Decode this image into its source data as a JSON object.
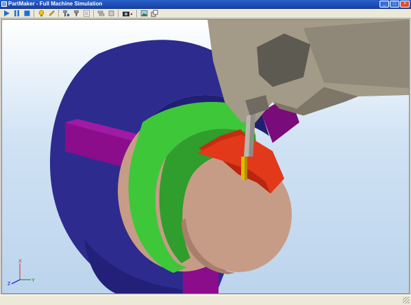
{
  "window": {
    "title": "PartMaker - Full Machine Simulation",
    "buttons": {
      "minimize": "_",
      "maximize": "□",
      "close": "×"
    }
  },
  "toolbar": {
    "icons": [
      "play-icon",
      "pause-icon",
      "stop-icon",
      "light-bulb-icon",
      "pencil-icon",
      "tool-holder-icon",
      "spindle-icon",
      "report-icon",
      "layers-icon",
      "rotate-icon",
      "camera-icon",
      "image-icon",
      "window-restore-icon"
    ]
  },
  "axis": {
    "x": "X",
    "y": "Y",
    "z": "Z"
  },
  "colors": {
    "chuck": "#2e2b8f",
    "jaw": "#8b0d8c",
    "stock_face": "#c79c86",
    "green_body": "#3fc73a",
    "machined_part": "#e2391a",
    "spindle_head": "#a39a88",
    "tool": "#e6b800"
  }
}
